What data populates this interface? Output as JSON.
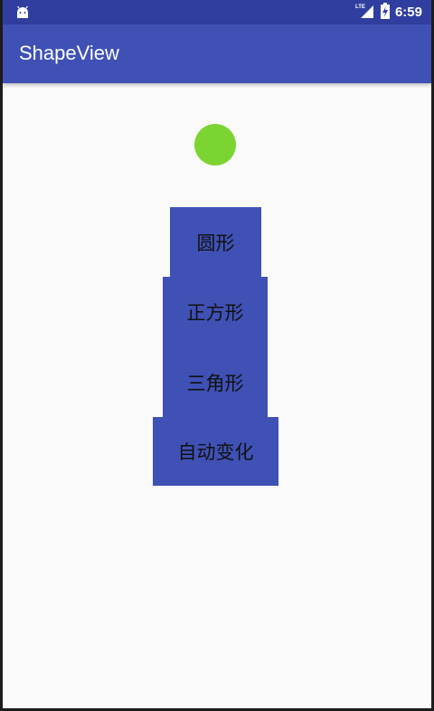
{
  "status_bar": {
    "network_type": "LTE",
    "time": "6:59",
    "icons": [
      "android-icon",
      "lte-signal-icon",
      "battery-charging-icon"
    ]
  },
  "app_bar": {
    "title": "ShapeView"
  },
  "shape_view": {
    "shape": "circle",
    "color": "#7cd432"
  },
  "buttons": [
    {
      "label": "圆形"
    },
    {
      "label": "正方形"
    },
    {
      "label": "三角形"
    },
    {
      "label": "自动变化"
    }
  ],
  "colors": {
    "primary": "#3f51b5",
    "primary_dark": "#303f9f",
    "shape_fill": "#7cd432",
    "background": "#fafafa"
  }
}
